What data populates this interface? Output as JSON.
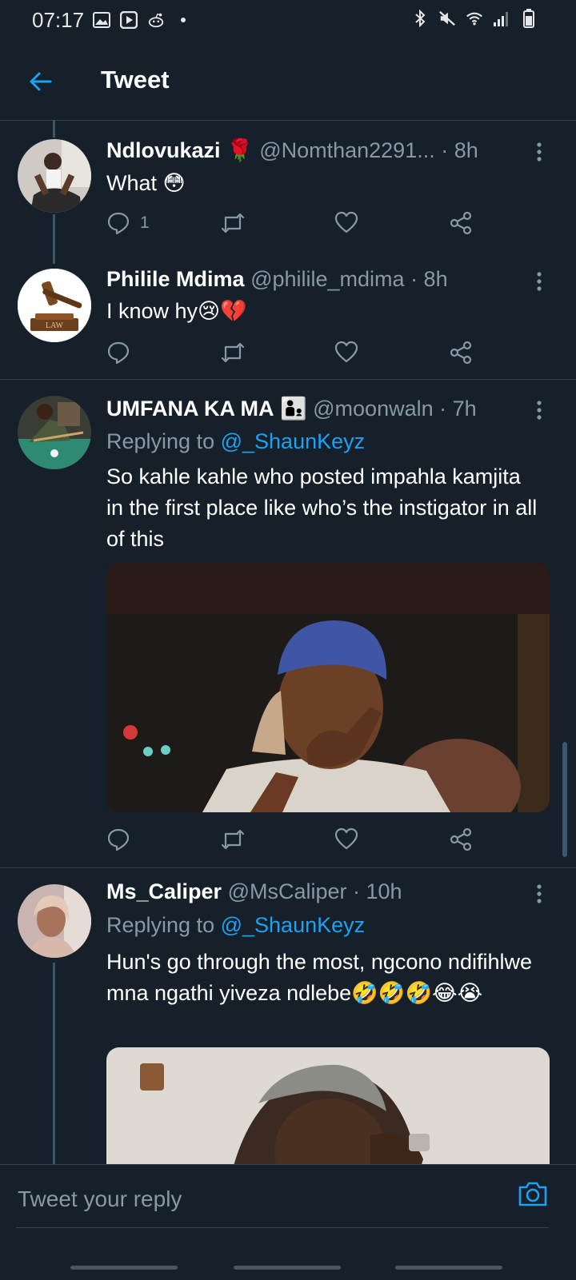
{
  "status_bar": {
    "time": "07:17"
  },
  "header": {
    "title": "Tweet"
  },
  "tweets": [
    {
      "name": "Ndlovukazi",
      "name_emoji": "🌹",
      "handle": "@Nomthan2291...",
      "time": "· 8h",
      "text": "What 😳",
      "reply_count": "1"
    },
    {
      "name": "Philile Mdima",
      "handle": "@philile_mdima",
      "time": "· 8h",
      "text": "I know hy😢💔",
      "avatar_label": "LAW"
    },
    {
      "name": "UMFANA KA MA",
      "name_emoji": "👨‍👦",
      "handle": "@moonwaln",
      "time": "· 7h",
      "replying_prefix": "Replying to",
      "replying_to": "@_ShaunKeyz",
      "text": "So kahle kahle who posted impahla kamjita in the first place like who’s the instigator in all of this"
    },
    {
      "name": "Ms_Caliper",
      "handle": "@MsCaliper",
      "time": "· 10h",
      "replying_prefix": "Replying to",
      "replying_to": "@_ShaunKeyz",
      "text": "Hun's go through the most, ngcono ndifihlwe mna ngathi yiveza ndlebe🤣🤣🤣😂😭"
    }
  ],
  "reply_bar": {
    "placeholder": "Tweet your reply"
  },
  "colors": {
    "background": "#15202b",
    "accent": "#1da1f2",
    "secondary_text": "#8899a6",
    "divider": "#38444d"
  },
  "icons": [
    "back-arrow-icon",
    "more-icon",
    "reply-icon",
    "retweet-icon",
    "like-icon",
    "share-icon",
    "camera-icon"
  ]
}
